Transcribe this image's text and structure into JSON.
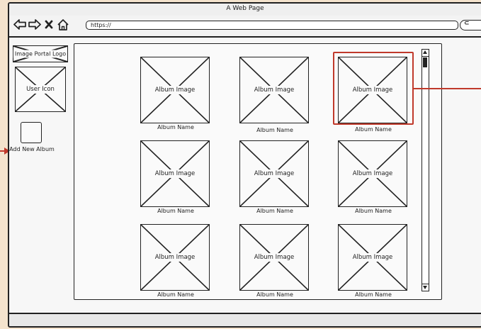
{
  "window": {
    "title": "A Web Page",
    "url": "https://"
  },
  "colors": {
    "background": "#f4e3cd",
    "selection_accent": "#c0392b",
    "ink": "#222222"
  },
  "toolbar": {
    "icons": [
      "back-arrow-icon",
      "forward-arrow-icon",
      "close-x-icon",
      "home-icon"
    ],
    "search_icon": "magnifier-icon"
  },
  "sidebar": {
    "logo_label": "Image Portal Logo",
    "user_icon_label": "User Icon",
    "add_album_label": "Add New Album"
  },
  "albums": [
    {
      "image_label": "Album Image",
      "name": "Album Name",
      "selected": false
    },
    {
      "image_label": "Album Image",
      "name": "Album Name",
      "selected": false
    },
    {
      "image_label": "Album Image",
      "name": "Album Name",
      "selected": true
    },
    {
      "image_label": "Album Image",
      "name": "Album Name",
      "selected": false
    },
    {
      "image_label": "Album Image",
      "name": "Album Name",
      "selected": false
    },
    {
      "image_label": "Album Image",
      "name": "Album Name",
      "selected": false
    },
    {
      "image_label": "Album Image",
      "name": "Album Name",
      "selected": false
    },
    {
      "image_label": "Album Image",
      "name": "Album Name",
      "selected": false
    },
    {
      "image_label": "Album Image",
      "name": "Album Name",
      "selected": false
    }
  ]
}
